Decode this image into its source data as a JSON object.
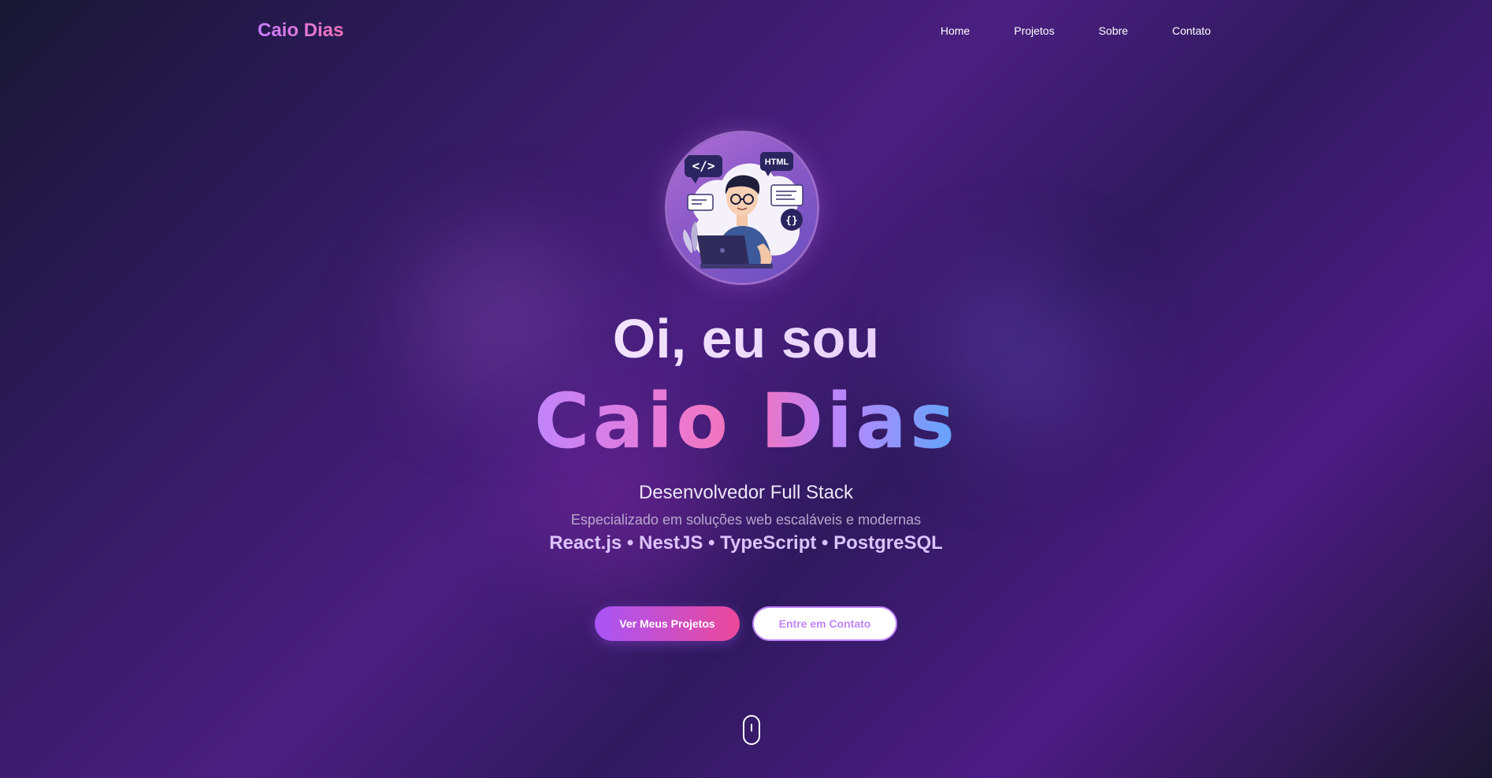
{
  "brand": {
    "logo": "Caio Dias"
  },
  "nav": {
    "items": [
      {
        "label": "Home"
      },
      {
        "label": "Projetos"
      },
      {
        "label": "Sobre"
      },
      {
        "label": "Contato"
      }
    ]
  },
  "hero": {
    "avatar_badges": {
      "code_tag": "</>",
      "html_tag": "HTML",
      "braces_tag": "{}"
    },
    "greeting": "Oi, eu sou",
    "name": "Caio Dias",
    "role": "Desenvolvedor Full Stack",
    "tagline": "Especializado em soluções web escaláveis e modernas",
    "stack": "React.js • NestJS • TypeScript • PostgreSQL",
    "primary_button": "Ver Meus Projetos",
    "secondary_button": "Entre em Contato"
  },
  "colors": {
    "accent_purple": "#a855f7",
    "accent_pink": "#ec4899",
    "accent_blue": "#60a5fa"
  },
  "icons": {
    "avatar": "developer-avatar-icon",
    "scroll": "mouse-scroll-icon"
  }
}
